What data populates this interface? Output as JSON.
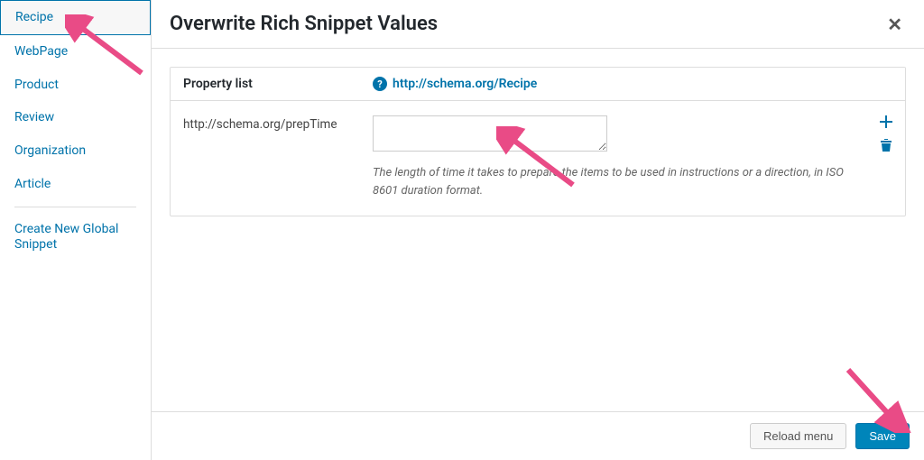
{
  "sidebar": {
    "items": [
      "Recipe",
      "WebPage",
      "Product",
      "Review",
      "Organization",
      "Article"
    ],
    "create_link": "Create New Global Snippet"
  },
  "header": {
    "title": "Overwrite Rich Snippet Values"
  },
  "panel": {
    "prop_header": "Property list",
    "schema_url": "http://schema.org/Recipe",
    "property": {
      "name": "http://schema.org/prepTime",
      "value": "",
      "description": "The length of time it takes to prepare the items to be used in instructions or a direction, in ISO 8601 duration format."
    }
  },
  "footer": {
    "reload": "Reload menu",
    "save": "Save"
  },
  "colors": {
    "accent": "#0073aa",
    "arrow": "#e94b86"
  }
}
